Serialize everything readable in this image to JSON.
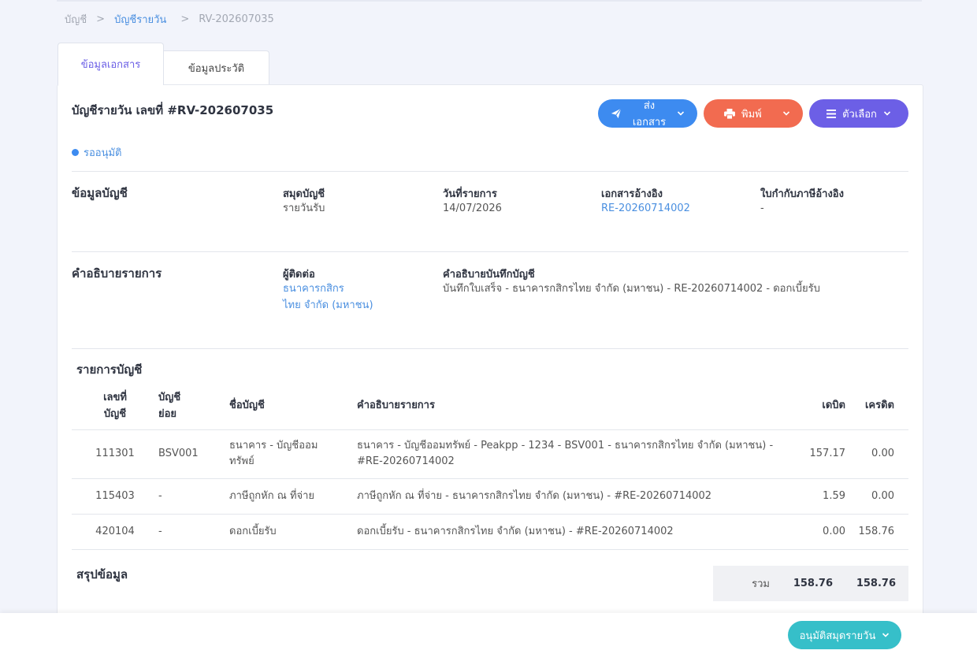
{
  "breadcrumb": {
    "items": [
      "บัญชี",
      "บัญชีรายวัน",
      "RV-202607035"
    ],
    "separator": ">"
  },
  "tabs": [
    {
      "label": "ข้อมูลเอกสาร",
      "active": true
    },
    {
      "label": "ข้อมูลประวัติ",
      "active": false
    }
  ],
  "document": {
    "title": "บัญชีรายวัน เลขที่ #RV-202607035",
    "status": "รออนุมัติ"
  },
  "actions": {
    "send_label": "ส่งเอกสาร",
    "print_label": "พิมพ์",
    "options_label": "ตัวเลือก",
    "approve_label": "อนุมัติสมุดรายวัน"
  },
  "account_info": {
    "section_title": "ข้อมูลบัญชี",
    "fields": [
      {
        "label": "สมุดบัญชี",
        "value": "รายวันรับ"
      },
      {
        "label": "วันที่รายการ",
        "value": "14/07/2026"
      },
      {
        "label": "เอกสารอ้างอิง",
        "value": "RE-20260714002"
      },
      {
        "label": "ใบกำกับภาษีอ้างอิง",
        "value": "-"
      }
    ]
  },
  "description": {
    "section_title": "คำอธิบายรายการ",
    "contact_label": "ผู้ติดต่อ",
    "contact_line1": "ธนาคารกสิกร",
    "contact_line2": "ไทย จำกัด (มหาชน)",
    "memo_label": "คำอธิบายบันทึกบัญชี",
    "memo_value": "บันทึกใบเสร็จ - ธนาคารกสิกรไทย จำกัด (มหาชน)  - RE-20260714002 - ดอกเบี้ยรับ"
  },
  "entries": {
    "section_title": "รายการบัญชี",
    "headers": {
      "account_no_1": "เลขที่",
      "account_no_2": "บัญชี",
      "sub_account_1": "บัญชี",
      "sub_account_2": "ย่อย",
      "account_name": "ชื่อบัญชี",
      "description": "คำอธิบายรายการ",
      "debit": "เดบิต",
      "credit": "เครดิต"
    },
    "rows": [
      {
        "account_no": "111301",
        "sub_account": "BSV001",
        "name_1": "ธนาคาร - บัญชีออม",
        "name_2": "ทรัพย์",
        "desc_1": "ธนาคาร - บัญชีออมทรัพย์ - Peakpp - 1234 - BSV001 - ธนาคารกสิกรไทย จำกัด (มหาชน)  -",
        "desc_2": "#RE-20260714002",
        "debit": "157.17",
        "credit": "0.00"
      },
      {
        "account_no": "115403",
        "sub_account": "-",
        "name_1": "ภาษีถูกหัก ณ ที่จ่าย",
        "name_2": "",
        "desc_1": "ภาษีถูกหัก ณ ที่จ่าย - ธนาคารกสิกรไทย จำกัด (มหาชน)  - #RE-20260714002",
        "desc_2": "",
        "debit": "1.59",
        "credit": "0.00"
      },
      {
        "account_no": "420104",
        "sub_account": "-",
        "name_1": "ดอกเบี้ยรับ",
        "name_2": "",
        "desc_1": "ดอกเบี้ยรับ - ธนาคารกสิกรไทย จำกัด (มหาชน)  - #RE-20260714002",
        "desc_2": "",
        "debit": "0.00",
        "credit": "158.76"
      }
    ]
  },
  "summary": {
    "section_title": "สรุปข้อมูล",
    "total_label": "รวม",
    "total_debit": "158.76",
    "total_credit": "158.76"
  },
  "icons": {
    "send": "paper-plane-icon",
    "print": "printer-icon",
    "options": "menu-icon",
    "chevron": "chevron-down-icon"
  },
  "colors": {
    "send": "#3d8bf0",
    "print": "#f26b50",
    "options": "#6c5fe6",
    "approve": "#36bfc9",
    "link": "#4a8fe0",
    "active_tab": "#6b5fe6"
  }
}
